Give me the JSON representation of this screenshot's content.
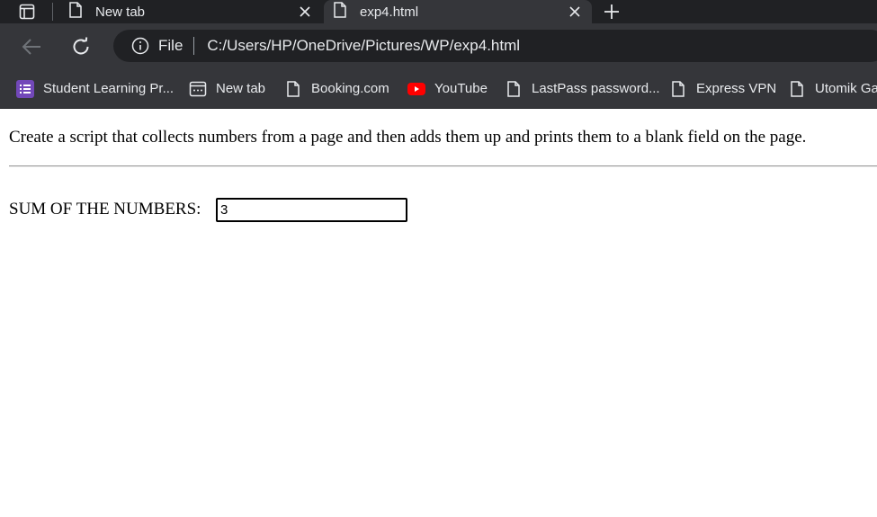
{
  "tabs": [
    {
      "title": "New tab"
    },
    {
      "title": "exp4.html"
    }
  ],
  "toolbar": {
    "scheme_label": "File",
    "url": "C:/Users/HP/OneDrive/Pictures/WP/exp4.html"
  },
  "bookmarks": [
    {
      "label": "Student Learning Pr...",
      "icon": "list-icon"
    },
    {
      "label": "New tab",
      "icon": "newtab-icon"
    },
    {
      "label": "Booking.com",
      "icon": "file-icon"
    },
    {
      "label": "YouTube",
      "icon": "youtube-icon"
    },
    {
      "label": "LastPass password...",
      "icon": "file-icon"
    },
    {
      "label": "Express VPN",
      "icon": "file-icon"
    },
    {
      "label": "Utomik Ga",
      "icon": "file-icon"
    }
  ],
  "page": {
    "intro_text": "Create a script that collects numbers from a page and then adds them up and prints them to a blank field on the page.",
    "sum_label": "SUM OF THE NUMBERS:",
    "sum_value": "3"
  },
  "colors": {
    "chrome_dark": "#202124",
    "chrome_mid": "#35363a",
    "youtube_red": "#ff0000",
    "list_purple": "#7248b9"
  }
}
